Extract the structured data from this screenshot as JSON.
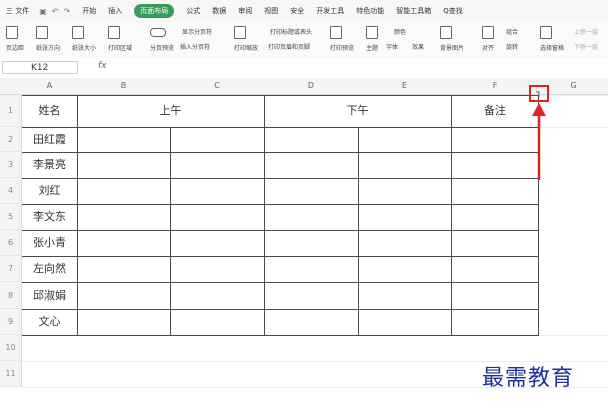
{
  "menubar": {
    "file": "三 文件",
    "items": [
      "开始",
      "插入",
      "页面布局",
      "公式",
      "数据",
      "审阅",
      "视图",
      "安全",
      "开发工具",
      "特色功能",
      "智能工具箱"
    ],
    "search": "Q查找"
  },
  "ribbon": {
    "page_margin": "页边距",
    "orientation": "纸张方向",
    "paper_size": "纸张大小",
    "print_area": "打印区域",
    "page_break_preview": "分页预览",
    "show_page_break": "显示分页符",
    "insert_page_break": "插入分页符",
    "print_scale": "打印缩放",
    "print_title": "打印标题或表头",
    "print_header_footer": "打印页眉和页脚",
    "print_preview": "打印预览",
    "theme": "主题",
    "font": "字体",
    "effect": "效果",
    "color": "颜色",
    "background": "背景图片",
    "align": "对齐",
    "rotate": "旋转",
    "group": "组合",
    "select_pane": "选择窗格",
    "prev_layer": "上移一层",
    "next_layer": "下移一层"
  },
  "formula_bar": {
    "cell_ref": "K12",
    "fx": "fx"
  },
  "columns": [
    "A",
    "B",
    "C",
    "D",
    "E",
    "F",
    "G"
  ],
  "rows": [
    "1",
    "2",
    "3",
    "4",
    "5",
    "6",
    "7",
    "8",
    "9",
    "10",
    "11"
  ],
  "table": {
    "name_header": "姓名",
    "am_header": "上午",
    "pm_header": "下午",
    "note_header": "备注",
    "names": [
      "田红霞",
      "李景亮",
      "刘红",
      "李文东",
      "张小青",
      "左向然",
      "邱淑娟",
      "文心"
    ]
  },
  "marker_glyph": "┐",
  "watermark": "最需教育",
  "colors": {
    "accent_green": "#3a9a5b",
    "highlight_red": "#e02424",
    "watermark_blue": "#20309a"
  }
}
